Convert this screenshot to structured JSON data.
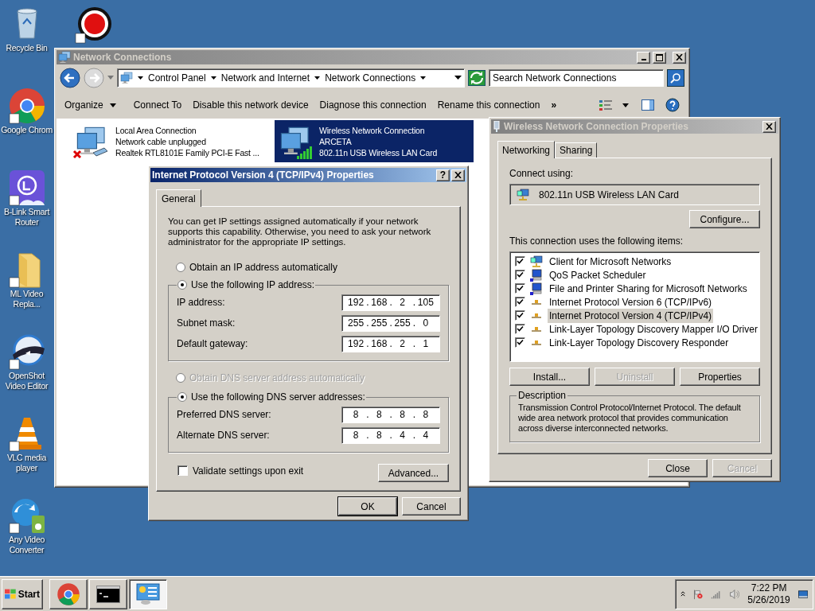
{
  "desktop_icons": [
    {
      "label": "Recycle Bin",
      "kind": "recycle"
    },
    {
      "label": "Google Chrom",
      "kind": "chrome"
    },
    {
      "label": "B-Link Smart Router",
      "kind": "blink"
    },
    {
      "label": "ML Video Repla...",
      "kind": "folder"
    },
    {
      "label": "OpenShot Video Editor",
      "kind": "openshot"
    },
    {
      "label": "VLC media player",
      "kind": "vlc"
    },
    {
      "label": "Any Video Converter",
      "kind": "anyvideo"
    }
  ],
  "network_window": {
    "title": "Network Connections",
    "address_path": [
      "Control Panel",
      "Network and Internet",
      "Network Connections"
    ],
    "search": {
      "placeholder": "Search Network Connections"
    },
    "commands": [
      {
        "label": "Organize",
        "kind": "menu"
      },
      {
        "label": "Connect To",
        "kind": "button"
      },
      {
        "label": "Disable this network device",
        "kind": "button"
      },
      {
        "label": "Diagnose this connection",
        "kind": "button"
      },
      {
        "label": "Rename this connection",
        "kind": "button"
      },
      {
        "label": "»",
        "kind": "more"
      }
    ],
    "connections": [
      {
        "name": "Local Area Connection",
        "status": "Network cable unplugged",
        "device": "Realtek RTL8101E Family PCI-E Fast ...",
        "kind": "wired",
        "unplugged": true,
        "selected": false
      },
      {
        "name": "Wireless Network Connection",
        "status": "ARCETA",
        "device": "802.11n USB Wireless LAN Card",
        "kind": "wireless",
        "unplugged": false,
        "selected": true
      }
    ]
  },
  "ipv4_dialog": {
    "title": "Internet Protocol Version 4 (TCP/IPv4) Properties",
    "help_button": "?",
    "tabs": [
      {
        "label": "General",
        "selected": true
      }
    ],
    "intro": "You can get IP settings assigned automatically if your network supports this capability. Otherwise, you need to ask your network administrator for the appropriate IP settings.",
    "ip_auto": {
      "label": "Obtain an IP address automatically",
      "selected": false,
      "disabled": false
    },
    "ip_manual": {
      "label": "Use the following IP address:",
      "selected": true,
      "disabled": false
    },
    "ip_fields": [
      {
        "label": "IP address:",
        "octets": [
          "192",
          ".",
          "168",
          ".",
          "2",
          ".",
          "105"
        ]
      },
      {
        "label": "Subnet mask:",
        "octets": [
          "255",
          ".",
          "255",
          ".",
          "255",
          ".",
          "0"
        ]
      },
      {
        "label": "Default gateway:",
        "octets": [
          "192",
          ".",
          "168",
          ".",
          "2",
          ".",
          "1"
        ]
      }
    ],
    "dns_auto": {
      "label": "Obtain DNS server address automatically",
      "selected": false,
      "disabled": true
    },
    "dns_manual": {
      "label": "Use the following DNS server addresses:",
      "selected": true,
      "disabled": false
    },
    "dns_fields": [
      {
        "label": "Preferred DNS server:",
        "octets": [
          "8",
          ".",
          "8",
          ".",
          "8",
          ".",
          "8"
        ]
      },
      {
        "label": "Alternate DNS server:",
        "octets": [
          "8",
          ".",
          "8",
          ".",
          "4",
          ".",
          "4"
        ]
      }
    ],
    "validate": {
      "label": "Validate settings upon exit",
      "checked": false
    },
    "advanced_button": "Advanced...",
    "ok_button": "OK",
    "cancel_button": "Cancel"
  },
  "properties_dialog": {
    "title": "Wireless Network Connection Properties",
    "tabs": [
      {
        "label": "Networking",
        "selected": true
      },
      {
        "label": "Sharing",
        "selected": false
      }
    ],
    "connect_using_label": "Connect using:",
    "adapter": "802.11n USB Wireless LAN Card",
    "configure_button": "Configure...",
    "items_label": "This connection uses the following items:",
    "items": [
      {
        "label": "Client for Microsoft Networks",
        "kind": "client",
        "checked": true,
        "selected": false
      },
      {
        "label": "QoS Packet Scheduler",
        "kind": "service",
        "checked": true,
        "selected": false
      },
      {
        "label": "File and Printer Sharing for Microsoft Networks",
        "kind": "service",
        "checked": true,
        "selected": false
      },
      {
        "label": "Internet Protocol Version 6 (TCP/IPv6)",
        "kind": "protocol",
        "checked": true,
        "selected": false
      },
      {
        "label": "Internet Protocol Version 4 (TCP/IPv4)",
        "kind": "protocol",
        "checked": true,
        "selected": true
      },
      {
        "label": "Link-Layer Topology Discovery Mapper I/O Driver",
        "kind": "protocol",
        "checked": true,
        "selected": false
      },
      {
        "label": "Link-Layer Topology Discovery Responder",
        "kind": "protocol",
        "checked": true,
        "selected": false
      }
    ],
    "buttons": [
      {
        "label": "Install...",
        "disabled": false
      },
      {
        "label": "Uninstall",
        "disabled": true
      },
      {
        "label": "Properties",
        "disabled": false
      }
    ],
    "description_label": "Description",
    "description": "Transmission Control Protocol/Internet Protocol. The default wide area network protocol that provides communication across diverse interconnected networks.",
    "footer_buttons": [
      {
        "label": "Close",
        "disabled": false
      },
      {
        "label": "Cancel",
        "disabled": true
      }
    ]
  },
  "taskbar": {
    "start": "Start",
    "apps": [
      {
        "kind": "chrome",
        "selected": false
      },
      {
        "kind": "console",
        "selected": false
      },
      {
        "kind": "control-panel",
        "selected": true
      }
    ],
    "time": "7:22 PM",
    "date": "5/26/2019"
  }
}
